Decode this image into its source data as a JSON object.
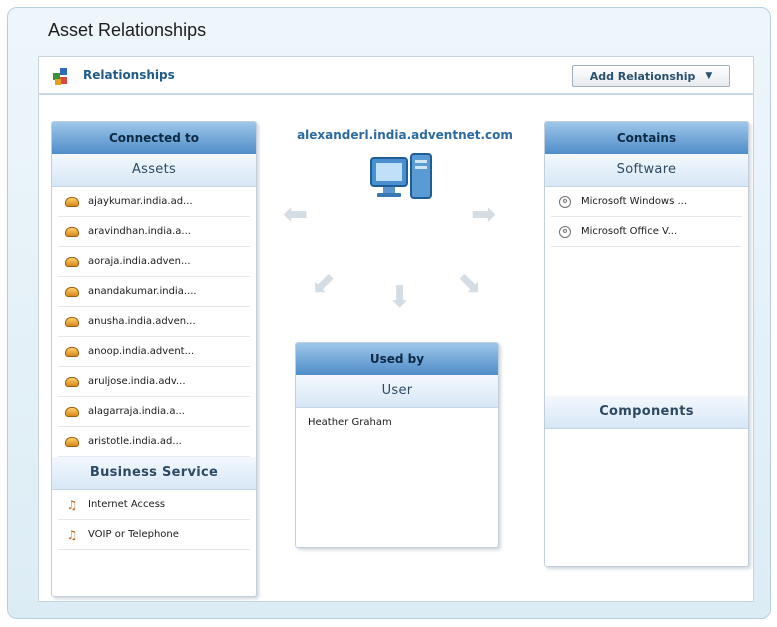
{
  "page": {
    "title": "Asset Relationships"
  },
  "header": {
    "section_title": "Relationships",
    "add_button": {
      "label": "Add Relationship",
      "caret": "▼"
    }
  },
  "center": {
    "host": "alexanderl.india.adventnet.com",
    "icon": "computer-icon"
  },
  "connected_to": {
    "title": "Connected to",
    "assets_label": "Assets",
    "assets": [
      "ajaykumar.india.ad...",
      "aravindhan.india.a...",
      "aoraja.india.adven...",
      "anandakumar.india....",
      "anusha.india.adven...",
      "anoop.india.advent...",
      "aruljose.india.adv...",
      "alagarraja.india.a...",
      "aristotle.india.ad..."
    ],
    "business_label": "Business Service",
    "business_services": [
      "Internet Access",
      "VOIP or Telephone"
    ]
  },
  "used_by": {
    "title": "Used by",
    "user_label": "User",
    "users": [
      "Heather Graham"
    ]
  },
  "contains": {
    "title": "Contains",
    "software_label": "Software",
    "software": [
      "Microsoft Windows ...",
      "Microsoft Office V..."
    ],
    "components_label": "Components"
  },
  "colors": {
    "link_blue": "#2d6aa0",
    "header_blue": "#4f8dc8",
    "background": "#dcecf5"
  }
}
